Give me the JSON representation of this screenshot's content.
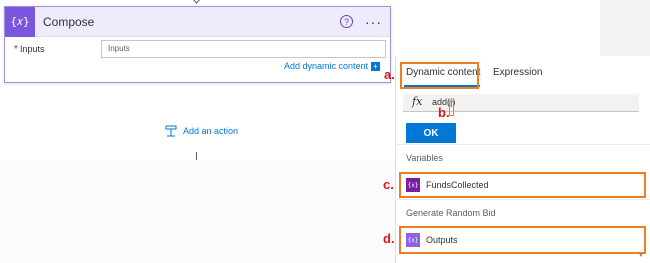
{
  "compose": {
    "icon_text": "{𝑥}",
    "title": "Compose",
    "help_icon": "?",
    "more_icon": "···",
    "inputs_label": "Inputs",
    "inputs_required_mark": "*",
    "inputs_placeholder": "Inputs",
    "add_dynamic_content": "Add dynamic content",
    "add_dynamic_button": "+"
  },
  "canvas": {
    "add_action_label": "Add an action",
    "add_action_icon": "add-action-icon"
  },
  "dynamic_panel": {
    "tabs": {
      "dynamic": "Dynamic content",
      "expression": "Expression"
    },
    "fx_label": "fx",
    "expression_value": "add(|)",
    "ok_label": "OK",
    "sections": [
      {
        "header": "Variables",
        "item": {
          "icon_text": "{x}",
          "label": "FundsCollected",
          "icon_color": "#7b1fa2"
        }
      },
      {
        "header": "Generate Random Bid",
        "item": {
          "icon_text": "{x}",
          "label": "Outputs",
          "icon_color": "#8a63e9"
        }
      }
    ]
  },
  "annotations": {
    "a": "a.",
    "b": "b.",
    "c": "c.",
    "d": "d."
  },
  "colors": {
    "accent": "#0078d4",
    "annotation_box": "#ef7d22",
    "annotation_text": "#d9161c",
    "compose_icon": "#7b57e0"
  }
}
